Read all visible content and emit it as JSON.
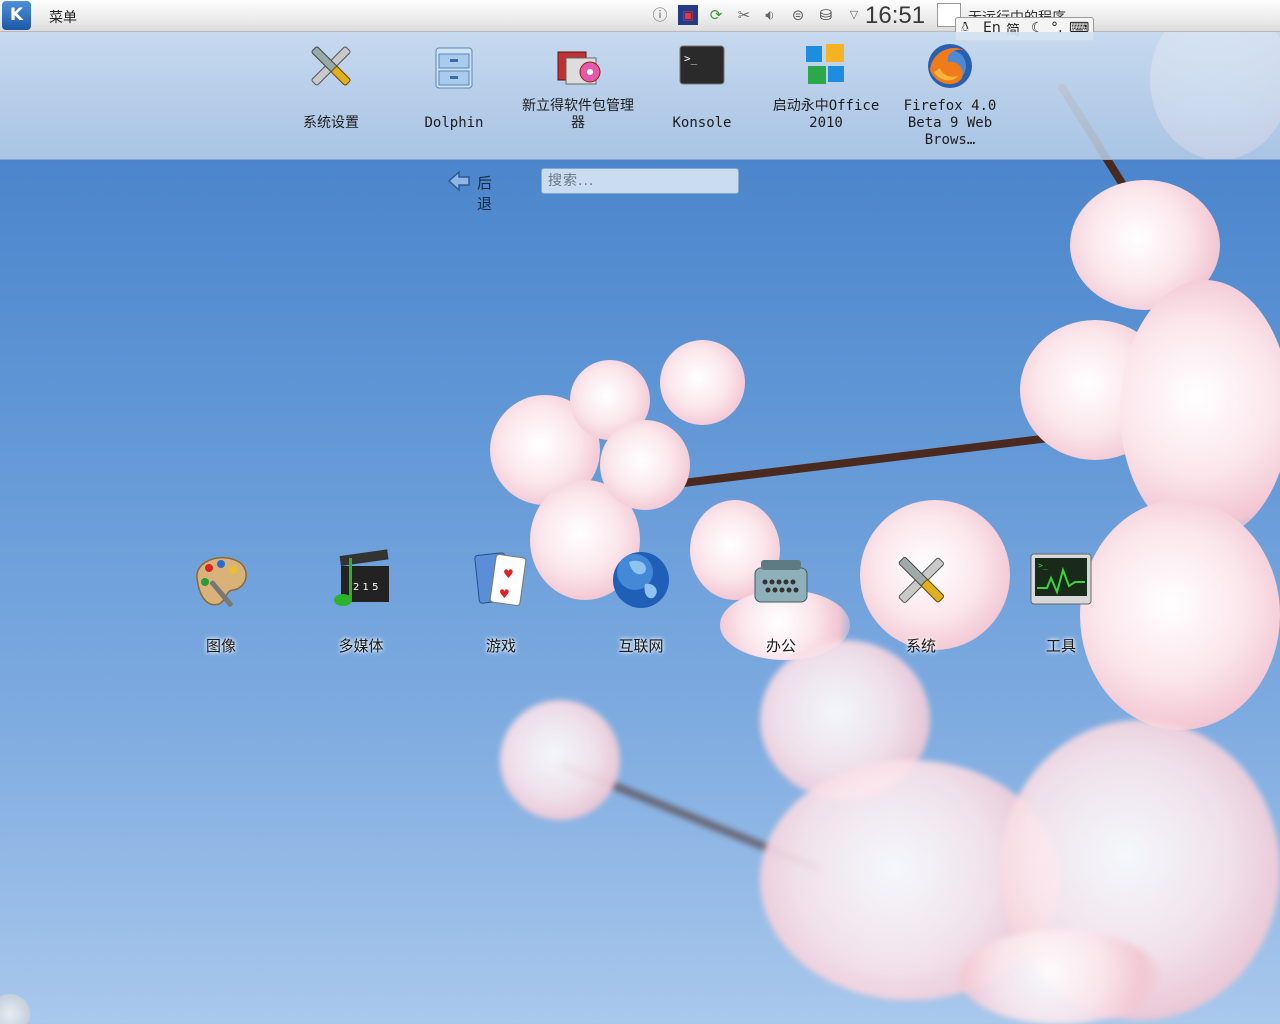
{
  "panel": {
    "menu_label": "菜单",
    "clock": "16:51",
    "task_title": "无运行中的程序",
    "ime": {
      "en": "En",
      "mode": "简",
      "extra": "°,"
    }
  },
  "favorites": [
    {
      "id": "system-settings",
      "label": "系统设置",
      "icon": "tools-icon"
    },
    {
      "id": "dolphin",
      "label": "Dolphin",
      "icon": "file-manager-icon"
    },
    {
      "id": "package-manager",
      "label": "新立得软件包管理器",
      "icon": "package-manager-icon"
    },
    {
      "id": "konsole",
      "label": "Konsole",
      "icon": "terminal-icon"
    },
    {
      "id": "office",
      "label": "启动永中Office 2010",
      "icon": "office-icon"
    },
    {
      "id": "firefox",
      "label": "Firefox 4.0 Beta 9 Web Brows…",
      "icon": "firefox-icon"
    }
  ],
  "navigation": {
    "back_label": "后退",
    "search_placeholder": "搜索..."
  },
  "categories": [
    {
      "id": "graphics",
      "label": "图像",
      "icon": "palette-icon"
    },
    {
      "id": "multimedia",
      "label": "多媒体",
      "icon": "multimedia-icon"
    },
    {
      "id": "games",
      "label": "游戏",
      "icon": "cards-icon"
    },
    {
      "id": "internet",
      "label": "互联网",
      "icon": "globe-icon"
    },
    {
      "id": "office",
      "label": "办公",
      "icon": "typewriter-icon"
    },
    {
      "id": "system",
      "label": "系统",
      "icon": "tools-icon"
    },
    {
      "id": "utilities",
      "label": "工具",
      "icon": "monitor-icon"
    }
  ],
  "colors": {
    "panel_bg": "#ececec",
    "sky": "#5b93d4",
    "blossom": "#f7d9e1",
    "branch": "#4a2a1e"
  }
}
